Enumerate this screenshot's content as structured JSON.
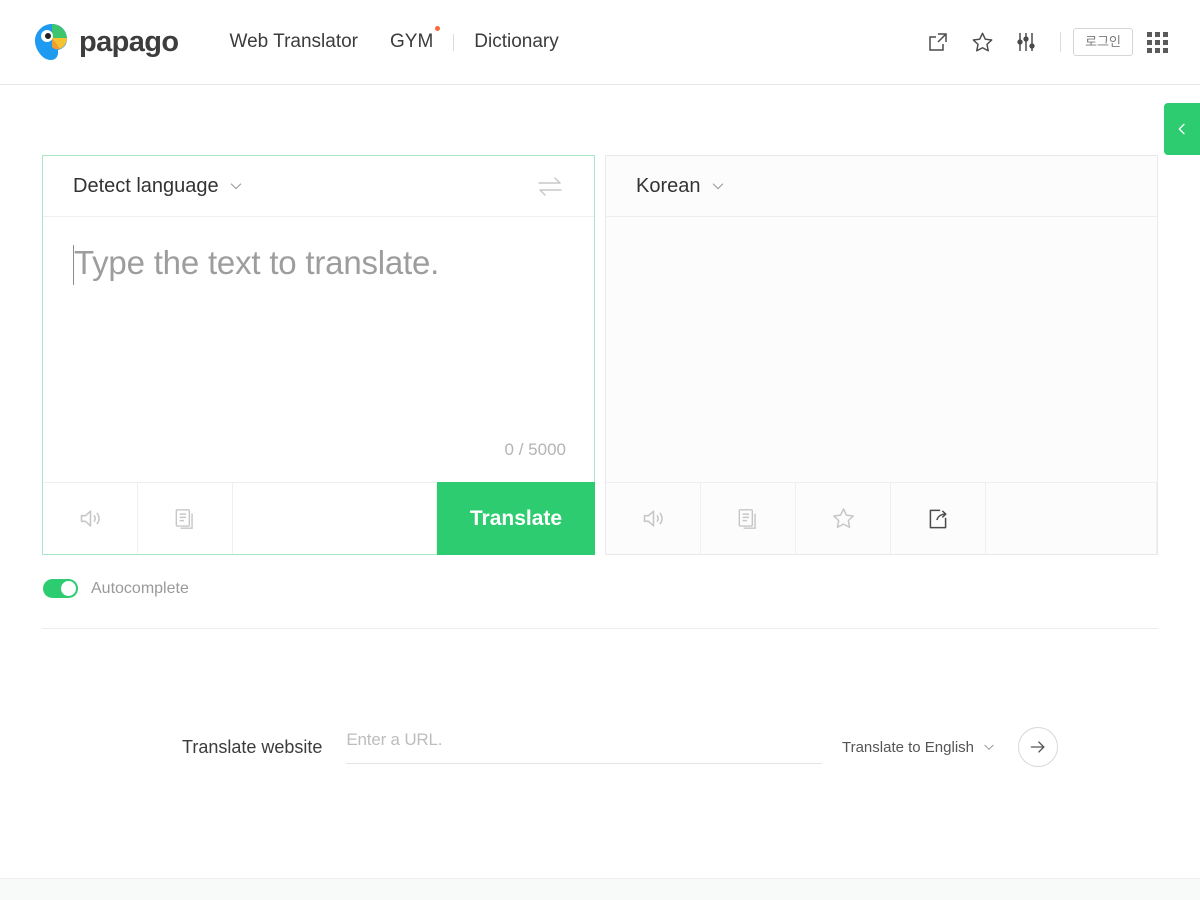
{
  "header": {
    "brand_name": "papago",
    "brand_logo_icon": "papago-parrot-logo",
    "nav": [
      {
        "label": "Web Translator",
        "badge_dot": false
      },
      {
        "label": "GYM",
        "badge_dot": true
      },
      {
        "label": "Dictionary",
        "badge_dot": false
      }
    ],
    "actions": [
      {
        "icon": "external-link-icon",
        "name": "share-page-button"
      },
      {
        "icon": "star-icon",
        "name": "favorites-button"
      },
      {
        "icon": "sliders-icon",
        "name": "settings-button"
      }
    ],
    "login_label": "로그인",
    "apps_icon": "grid-apps-icon"
  },
  "side_tab": {
    "icon": "chevron-left-icon",
    "color": "#2ecc71"
  },
  "source_panel": {
    "language": "Detect language",
    "chevron_icon": "chevron-down-icon",
    "swap_icon": "swap-arrows-icon",
    "placeholder": "Type the text to translate.",
    "value": "",
    "char_count": "0 / 5000",
    "char_current": 0,
    "char_max": 5000,
    "tools": [
      {
        "icon": "speaker-icon",
        "name": "source-tts-button"
      },
      {
        "icon": "copy-document-icon",
        "name": "source-copy-button"
      }
    ],
    "translate_label": "Translate",
    "accent_color": "#2ecc71",
    "border_color": "#a9e6c4"
  },
  "target_panel": {
    "language": "Korean",
    "chevron_icon": "chevron-down-icon",
    "value": "",
    "tools": [
      {
        "icon": "speaker-icon",
        "name": "target-tts-button"
      },
      {
        "icon": "copy-document-icon",
        "name": "target-copy-button"
      },
      {
        "icon": "star-icon",
        "name": "target-favorite-button"
      },
      {
        "icon": "share-box-icon",
        "name": "target-share-button"
      }
    ]
  },
  "autocomplete": {
    "label": "Autocomplete",
    "enabled": true,
    "on_color": "#2ecc71"
  },
  "website_translate": {
    "label": "Translate website",
    "url_placeholder": "Enter a URL.",
    "url_value": "",
    "target_language": "Translate to English",
    "chevron_icon": "chevron-down-icon",
    "go_icon": "arrow-right-icon"
  }
}
